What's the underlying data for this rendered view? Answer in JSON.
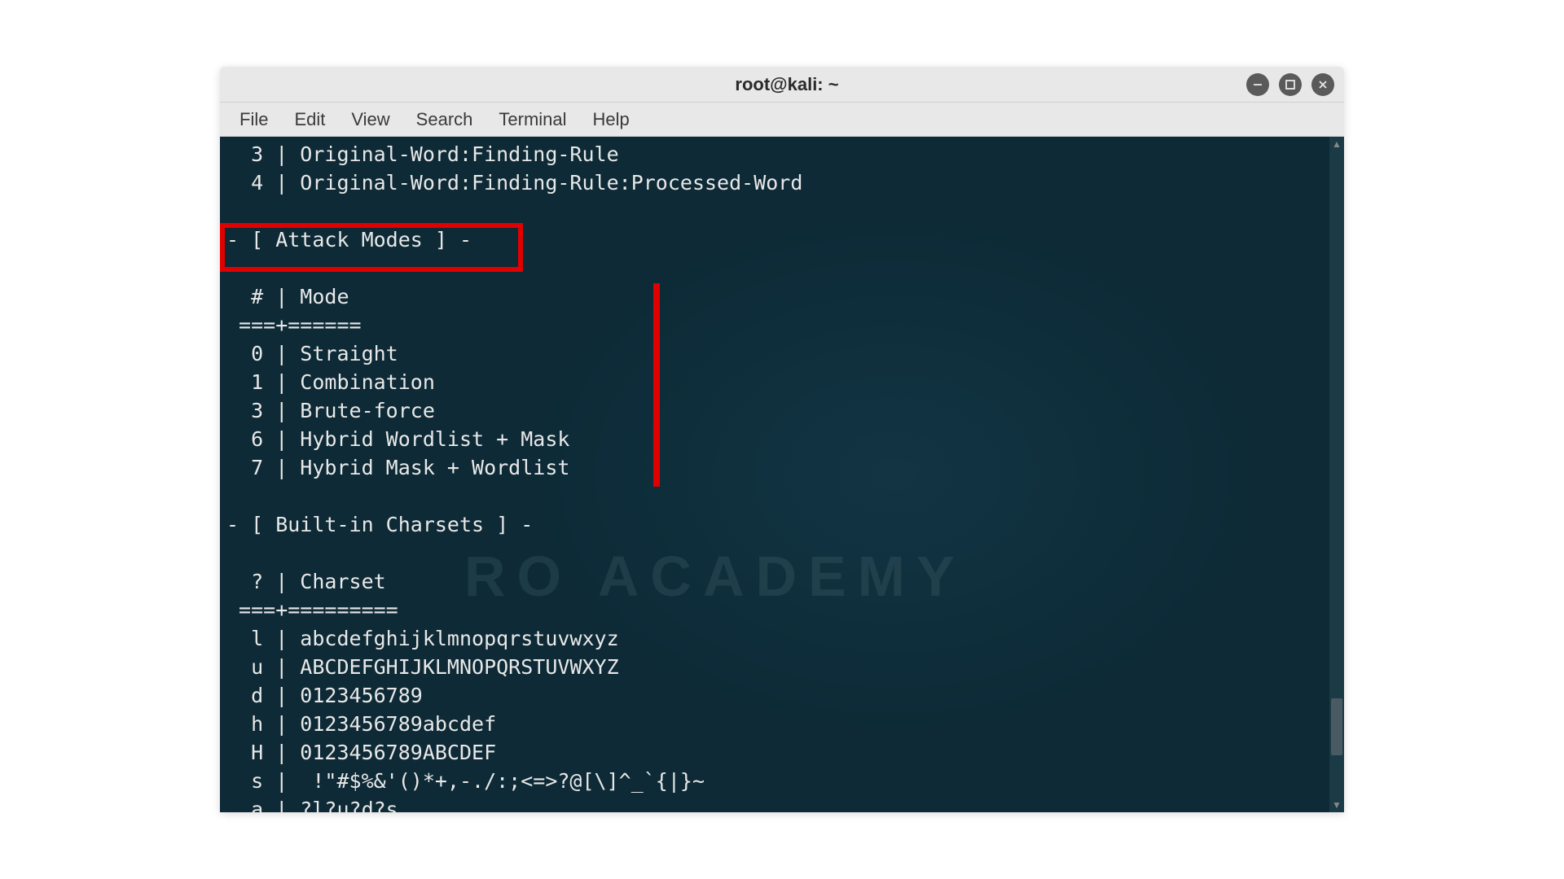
{
  "window": {
    "title": "root@kali: ~"
  },
  "menubar": {
    "items": [
      "File",
      "Edit",
      "View",
      "Search",
      "Terminal",
      "Help"
    ]
  },
  "watermark": "RO ACADEMY",
  "terminal": {
    "lines": [
      "  3 | Original-Word:Finding-Rule",
      "  4 | Original-Word:Finding-Rule:Processed-Word",
      "",
      "- [ Attack Modes ] -",
      "",
      "  # | Mode",
      " ===+======",
      "  0 | Straight",
      "  1 | Combination",
      "  3 | Brute-force",
      "  6 | Hybrid Wordlist + Mask",
      "  7 | Hybrid Mask + Wordlist",
      "",
      "- [ Built-in Charsets ] -",
      "",
      "  ? | Charset",
      " ===+=========",
      "  l | abcdefghijklmnopqrstuvwxyz",
      "  u | ABCDEFGHIJKLMNOPQRSTUVWXYZ",
      "  d | 0123456789",
      "  h | 0123456789abcdef",
      "  H | 0123456789ABCDEF",
      "  s |  !\"#$%&'()*+,-./:;<=>?@[\\]^_`{|}~",
      "  a | ?l?u?d?s"
    ]
  }
}
